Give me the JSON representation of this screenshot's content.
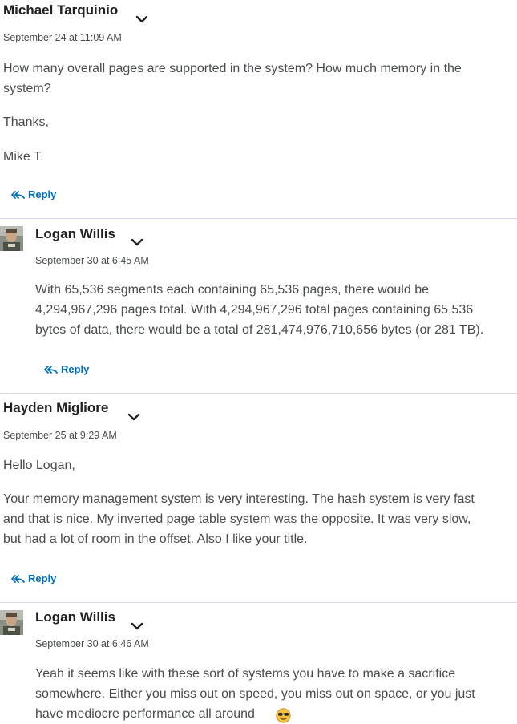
{
  "colors": {
    "accent": "#006fbf",
    "text": "#494c4e",
    "author": "#202122",
    "divider": "#d3d9e3"
  },
  "posts": [
    {
      "author": "Michael Tarquinio",
      "date": "September 24 at 11:09 AM",
      "body": [
        "How many overall pages are supported in the system?  How much memory in the",
        "system?",
        "Thanks,",
        "Mike T."
      ],
      "reply_label": "Reply"
    },
    {
      "author": "Logan Willis",
      "date": "September 30 at 6:45 AM",
      "body": [
        "With 65,536 segments each containing 65,536 pages, there would be",
        "4,294,967,296 pages total.  With 4,294,967,296 total pages containing 65,536",
        "bytes of data, there would be a total of 281,474,976,710,656 bytes (or 281 TB)."
      ],
      "reply_label": "Reply"
    },
    {
      "author": "Hayden Migliore",
      "date": "September 25 at 9:29 AM",
      "body": [
        "Hello Logan,",
        "Your memory management system is very interesting. The hash system is very fast",
        "and that is nice. My inverted page table system was the opposite. It was very slow,",
        "but had a lot of room in the offset. Also I like your title."
      ],
      "reply_label": "Reply"
    },
    {
      "author": "Logan Willis",
      "date": "September 30 at 6:46 AM",
      "body": [
        "Yeah it seems like with these sort of systems you have to make a sacrifice",
        "somewhere.  Either you miss out on speed, you miss out on space, or you just",
        "have mediocre performance all around"
      ],
      "emoji": "smiling-face-with-sunglasses"
    }
  ]
}
